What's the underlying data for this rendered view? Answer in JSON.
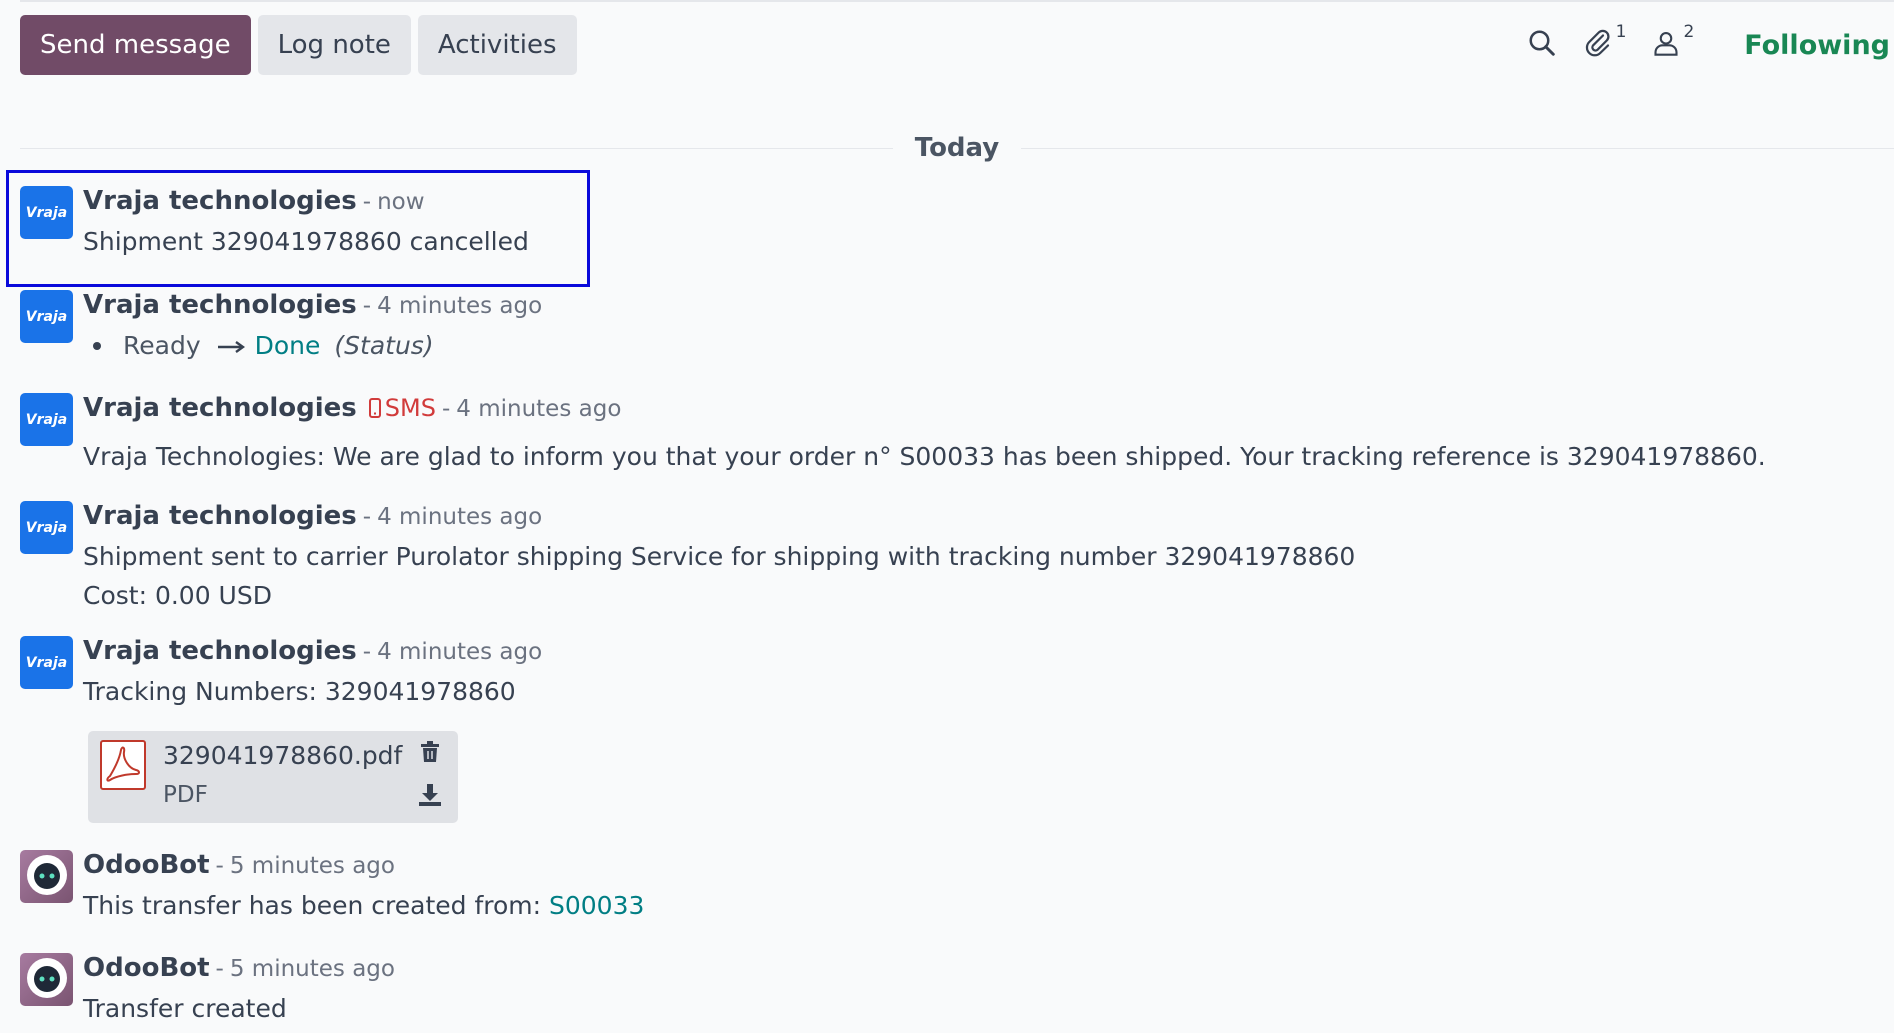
{
  "toolbar": {
    "send_message": "Send message",
    "log_note": "Log note",
    "activities": "Activities",
    "attachments_count": "1",
    "followers_count": "2",
    "following": "Following"
  },
  "separator": {
    "label": "Today"
  },
  "messages": [
    {
      "author": "Vraja technologies",
      "dash": "-",
      "time": "now",
      "avatar_text": "Vraja",
      "body": "Shipment 329041978860 cancelled"
    },
    {
      "author": "Vraja technologies",
      "dash": "-",
      "time": "4 minutes ago",
      "avatar_text": "Vraja",
      "tracking": {
        "old": "Ready",
        "new": "Done",
        "field": "(Status)"
      }
    },
    {
      "author": "Vraja technologies",
      "dash": "-",
      "time": "4 minutes ago",
      "avatar_text": "Vraja",
      "sms_label": "SMS",
      "body": " Vraja Technologies: We are glad to inform you that your order n° S00033 has been shipped. Your tracking reference is 329041978860."
    },
    {
      "author": "Vraja technologies",
      "dash": "-",
      "time": "4 minutes ago",
      "avatar_text": "Vraja",
      "body_line1": "Shipment sent to carrier Purolator shipping Service for shipping with tracking number 329041978860",
      "body_line2": "Cost: 0.00 USD"
    },
    {
      "author": "Vraja technologies",
      "dash": "-",
      "time": "4 minutes ago",
      "avatar_text": "Vraja",
      "body": "Tracking Numbers: 329041978860",
      "attachment": {
        "name": "329041978860.pdf",
        "type": "PDF"
      }
    },
    {
      "author": "OdooBot",
      "dash": "-",
      "time": "5 minutes ago",
      "body_prefix": "This transfer has been created from: ",
      "body_link": "S00033"
    },
    {
      "author": "OdooBot",
      "dash": "-",
      "time": "5 minutes ago",
      "body": "Transfer created"
    }
  ],
  "colors": {
    "primary": "#714b67",
    "following": "#198754",
    "link": "#017e84",
    "sms": "#d13b3b",
    "highlight": "#0a0adb"
  }
}
